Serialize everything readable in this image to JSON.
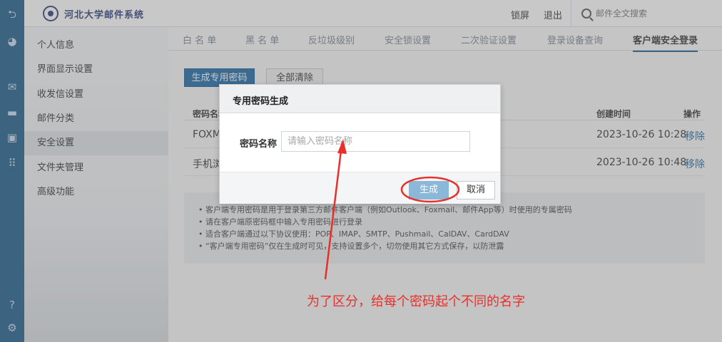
{
  "rail": {
    "icons": [
      "back-icon",
      "avatar-icon",
      "mail-icon",
      "folder-icon",
      "contacts-icon",
      "apps-icon",
      "help-icon",
      "settings-icon"
    ]
  },
  "header": {
    "logo_text": "河北大学邮件系统",
    "lock_label": "锁屏",
    "logout_label": "退出",
    "search_placeholder": "邮件全文搜索"
  },
  "sidebar": {
    "items": [
      {
        "label": "个人信息"
      },
      {
        "label": "界面显示设置"
      },
      {
        "label": "收发信设置"
      },
      {
        "label": "邮件分类"
      },
      {
        "label": "安全设置",
        "active": true
      },
      {
        "label": "文件夹管理"
      },
      {
        "label": "高级功能"
      }
    ]
  },
  "tabs": [
    {
      "label": "白 名 单"
    },
    {
      "label": "黑 名 单"
    },
    {
      "label": "反垃圾级别"
    },
    {
      "label": "安全锁设置"
    },
    {
      "label": "二次验证设置"
    },
    {
      "label": "登录设备查询"
    },
    {
      "label": "客户端安全登录",
      "active": true
    }
  ],
  "toolbar": {
    "generate_label": "生成专用密码",
    "clear_label": "全部清除"
  },
  "table": {
    "columns": [
      "密码名称",
      "创建时间",
      "操作"
    ],
    "rows": [
      {
        "name": "FOXM",
        "created": "2023-10-26 10:28",
        "action": "移除"
      },
      {
        "name": "手机浏",
        "created": "2023-10-26 10:48",
        "action": "移除"
      }
    ]
  },
  "notes": [
    "• 客户端专用密码是用于登录第三方邮件客户端（例如Outlook、Foxmail、邮件App等）时使用的专属密码",
    "• 请在客户端原密码框中输入专用密码进行登录",
    "• 适合客户端通过以下协议使用：POP、IMAP、SMTP、Pushmail、CalDAV、CardDAV",
    "• “客户端专用密码”仅在生成时可见，支持设置多个，切勿使用其它方式保存，以防泄露"
  ],
  "modal": {
    "title": "专用密码生成",
    "field_label": "密码名称",
    "field_placeholder": "请输入密码名称",
    "field_value": "",
    "generate_label": "生成",
    "cancel_label": "取消"
  },
  "annotation": {
    "text": "为了区分，给每个密码起个不同的名字",
    "color": "#e8302a"
  },
  "colors": {
    "rail": "#1d5c8c",
    "primary": "#1d6aa8",
    "link": "#1d6aa8",
    "annotation": "#e8302a"
  }
}
